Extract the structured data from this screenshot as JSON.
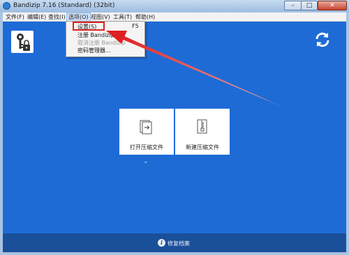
{
  "window": {
    "title": "Bandizip 7.16 (Standard) (32bit)",
    "controls": {
      "minimize": "–",
      "maximize": "□",
      "close": "✕"
    }
  },
  "menubar": {
    "items": [
      "文件(F)",
      "编辑(E)",
      "查找(I)",
      "选项(O)",
      "视图(V)",
      "工具(T)",
      "帮助(H)"
    ]
  },
  "options_menu": {
    "items": [
      {
        "label": "设置(S)",
        "shortcut": "F5",
        "enabled": true
      },
      {
        "label": "注册 Bandizip",
        "enabled": true
      },
      {
        "label": "取消注册 Bandizip",
        "enabled": false
      },
      {
        "label": "密码管理器...",
        "enabled": true
      }
    ]
  },
  "main": {
    "tiles": [
      {
        "label": "打开压缩文件",
        "icon": "open-archive-icon"
      },
      {
        "label": "新建压缩文件",
        "icon": "new-archive-icon"
      }
    ],
    "expand_glyph": "⌄"
  },
  "footer": {
    "icon_glyph": "i",
    "label": "修复档案"
  },
  "colors": {
    "client_bg": "#1e6bd6",
    "footer_bg": "#1a4f99",
    "annotation_red": "#e02020"
  }
}
